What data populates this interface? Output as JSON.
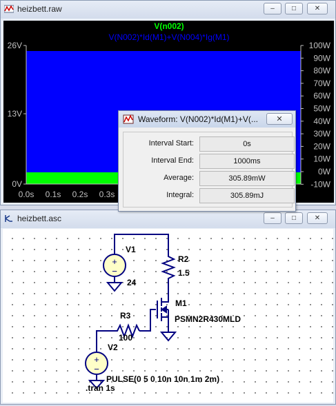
{
  "waveform_window": {
    "title": "heizbett.raw",
    "trace1_label": "V(n002)",
    "trace2_label": "V(N002)*Id(M1)+V(N004)*Ig(M1)",
    "trace1_color": "#00ff00",
    "trace2_color": "#0000ff",
    "left_axis_ticks": [
      "26V",
      "13V",
      "0V"
    ],
    "right_axis_ticks": [
      "100W",
      "90W",
      "80W",
      "70W",
      "60W",
      "50W",
      "40W",
      "30W",
      "20W",
      "10W",
      "0W",
      "-10W"
    ],
    "x_axis_ticks": [
      "0.0s",
      "0.1s",
      "0.2s",
      "0.3s"
    ],
    "minimize_label": "–",
    "restore_label": "□",
    "close_label": "✕"
  },
  "dialog": {
    "title": "Waveform: V(N002)*Id(M1)+V(...",
    "close_label": "✕",
    "rows": [
      {
        "label": "Interval Start:",
        "value": "0s"
      },
      {
        "label": "Interval End:",
        "value": "1000ms"
      },
      {
        "label": "Average:",
        "value": "305.89mW"
      },
      {
        "label": "Integral:",
        "value": "305.89mJ"
      }
    ]
  },
  "schematic_window": {
    "title": "heizbett.asc",
    "minimize_label": "–",
    "restore_label": "□",
    "close_label": "✕",
    "components": {
      "v1_name": "V1",
      "v1_value": "24",
      "r2_name": "R2",
      "r2_value": "1.5",
      "m1_name": "M1",
      "m1_value": "PSMN2R430MLD",
      "r3_name": "R3",
      "r3_value": "100",
      "v2_name": "V2",
      "v2_value": "PULSE(0 5 0 10n 10n 1m 2m)"
    },
    "directive": ".tran 1s"
  }
}
